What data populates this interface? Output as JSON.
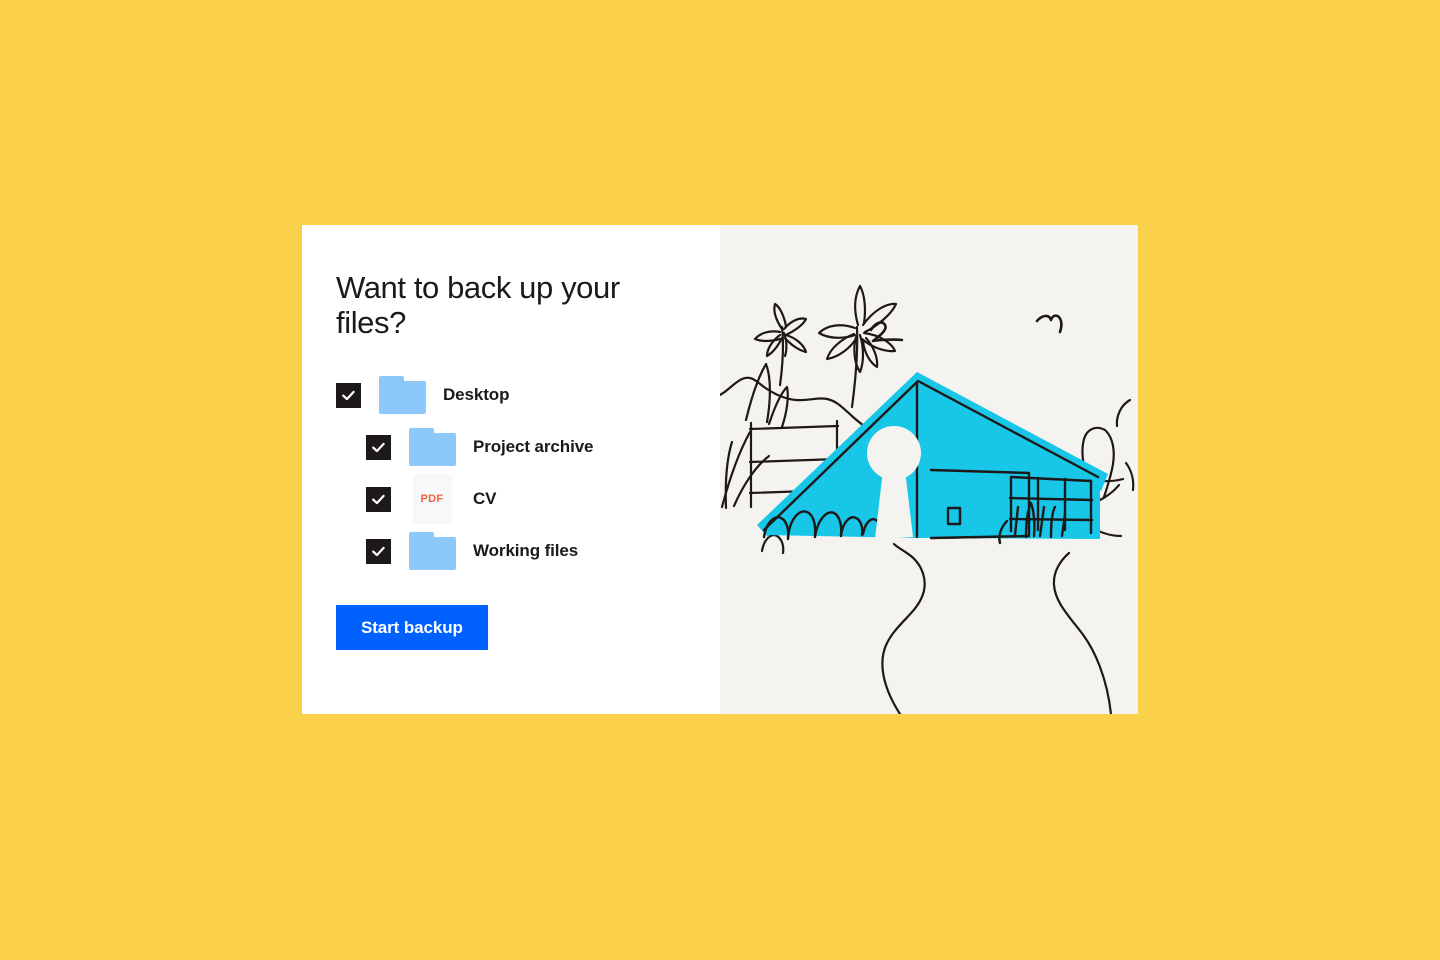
{
  "page": {
    "background_color": "#FBD14B",
    "card_background": "#FFFFFF"
  },
  "card": {
    "title": "Want to back up your files?",
    "accent_color": "#0061FF",
    "checkbox_color": "#1E1919",
    "folder_color": "#8CC8FA",
    "pdf_text_color": "#F5603B"
  },
  "folder_list": {
    "items": [
      {
        "label": "Desktop",
        "icon": "folder-icon",
        "checked": true,
        "checkbox_name": "checkbox-desktop",
        "depth": 0
      },
      {
        "label": "Project archive",
        "icon": "folder-icon",
        "checked": true,
        "checkbox_name": "checkbox-project-archive",
        "depth": 1
      },
      {
        "label": "CV",
        "icon": "pdf-file-icon",
        "icon_text": "PDF",
        "checked": true,
        "checkbox_name": "checkbox-cv",
        "depth": 1
      },
      {
        "label": "Working files",
        "icon": "folder-icon",
        "checked": true,
        "checkbox_name": "checkbox-working-files",
        "depth": 1
      }
    ]
  },
  "actions": {
    "start_backup_label": "Start backup"
  },
  "illustration": {
    "name": "house-with-keyhole-illustration",
    "background_color": "#F5F3EF",
    "house_color": "#18C6E8",
    "line_color": "#1E1919",
    "elements": [
      "bird-doodle-left",
      "bird-doodle-right",
      "mountain-range",
      "palm-tree-small",
      "palm-tree-large",
      "house-roof",
      "house-keyhole",
      "house-door",
      "house-window",
      "garden-fence",
      "bushes",
      "winding-path"
    ]
  }
}
